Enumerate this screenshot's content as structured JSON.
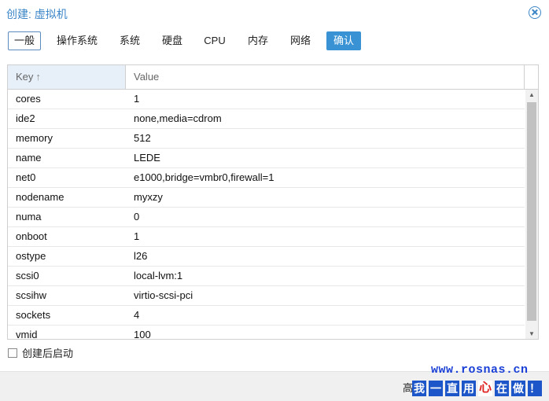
{
  "dialog": {
    "title": "创建: 虚拟机"
  },
  "tabs": [
    {
      "label": "一般"
    },
    {
      "label": "操作系统"
    },
    {
      "label": "系统"
    },
    {
      "label": "硬盘"
    },
    {
      "label": "CPU"
    },
    {
      "label": "内存"
    },
    {
      "label": "网络"
    },
    {
      "label": "确认"
    }
  ],
  "grid": {
    "columns": {
      "key": "Key",
      "key_sort_icon": "↑",
      "value": "Value"
    },
    "rows": [
      {
        "key": "cores",
        "value": "1"
      },
      {
        "key": "ide2",
        "value": "none,media=cdrom"
      },
      {
        "key": "memory",
        "value": "512"
      },
      {
        "key": "name",
        "value": "LEDE"
      },
      {
        "key": "net0",
        "value": "e1000,bridge=vmbr0,firewall=1"
      },
      {
        "key": "nodename",
        "value": "myxzy"
      },
      {
        "key": "numa",
        "value": "0"
      },
      {
        "key": "onboot",
        "value": "1"
      },
      {
        "key": "ostype",
        "value": "l26"
      },
      {
        "key": "scsi0",
        "value": "local-lvm:1"
      },
      {
        "key": "scsihw",
        "value": "virtio-scsi-pci"
      },
      {
        "key": "sockets",
        "value": "4"
      },
      {
        "key": "vmid",
        "value": "100"
      }
    ]
  },
  "start_after_create": {
    "label": "创建后启动",
    "checked": false
  },
  "footer": {
    "advanced_label": "高"
  },
  "watermark": {
    "url": "www.rosnas.cn",
    "slogan": [
      "我",
      "一",
      "直",
      "用",
      "心",
      "在",
      "做",
      "！"
    ]
  }
}
